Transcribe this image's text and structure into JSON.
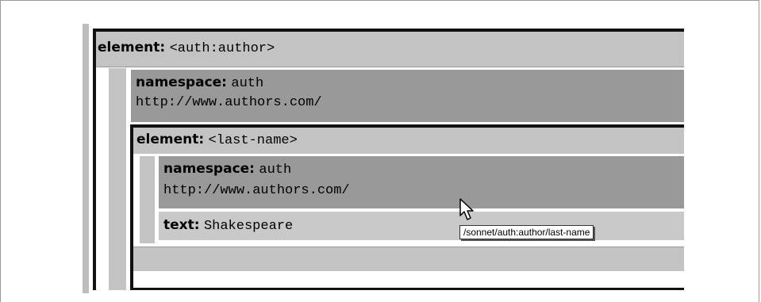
{
  "outer_element": {
    "keyword": "element:",
    "value": "<auth:author>"
  },
  "outer_namespace": {
    "keyword": "namespace:",
    "prefix": "auth",
    "uri": "http://www.authors.com/"
  },
  "inner_element": {
    "keyword": "element:",
    "value": "<last-name>"
  },
  "inner_namespace": {
    "keyword": "namespace:",
    "prefix": "auth",
    "uri": "http://www.authors.com/"
  },
  "text_node": {
    "keyword": "text:",
    "value": "Shakespeare"
  },
  "tooltip": {
    "text": "/sonnet/auth:author/last-name"
  },
  "cursor": {
    "icon": "arrow-pointer-icon"
  }
}
